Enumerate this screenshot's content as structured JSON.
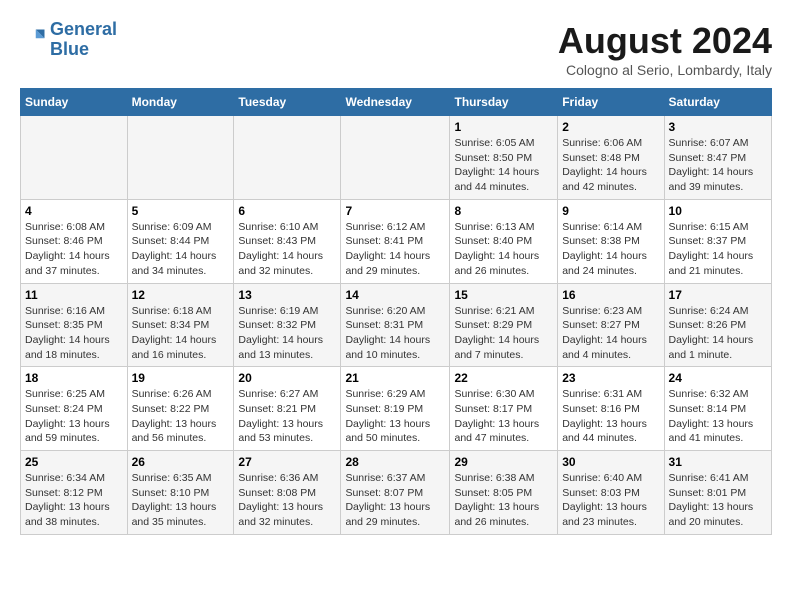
{
  "header": {
    "logo_line1": "General",
    "logo_line2": "Blue",
    "month_title": "August 2024",
    "location": "Cologno al Serio, Lombardy, Italy"
  },
  "days_of_week": [
    "Sunday",
    "Monday",
    "Tuesday",
    "Wednesday",
    "Thursday",
    "Friday",
    "Saturday"
  ],
  "weeks": [
    [
      {
        "day": "",
        "info": ""
      },
      {
        "day": "",
        "info": ""
      },
      {
        "day": "",
        "info": ""
      },
      {
        "day": "",
        "info": ""
      },
      {
        "day": "1",
        "info": "Sunrise: 6:05 AM\nSunset: 8:50 PM\nDaylight: 14 hours\nand 44 minutes."
      },
      {
        "day": "2",
        "info": "Sunrise: 6:06 AM\nSunset: 8:48 PM\nDaylight: 14 hours\nand 42 minutes."
      },
      {
        "day": "3",
        "info": "Sunrise: 6:07 AM\nSunset: 8:47 PM\nDaylight: 14 hours\nand 39 minutes."
      }
    ],
    [
      {
        "day": "4",
        "info": "Sunrise: 6:08 AM\nSunset: 8:46 PM\nDaylight: 14 hours\nand 37 minutes."
      },
      {
        "day": "5",
        "info": "Sunrise: 6:09 AM\nSunset: 8:44 PM\nDaylight: 14 hours\nand 34 minutes."
      },
      {
        "day": "6",
        "info": "Sunrise: 6:10 AM\nSunset: 8:43 PM\nDaylight: 14 hours\nand 32 minutes."
      },
      {
        "day": "7",
        "info": "Sunrise: 6:12 AM\nSunset: 8:41 PM\nDaylight: 14 hours\nand 29 minutes."
      },
      {
        "day": "8",
        "info": "Sunrise: 6:13 AM\nSunset: 8:40 PM\nDaylight: 14 hours\nand 26 minutes."
      },
      {
        "day": "9",
        "info": "Sunrise: 6:14 AM\nSunset: 8:38 PM\nDaylight: 14 hours\nand 24 minutes."
      },
      {
        "day": "10",
        "info": "Sunrise: 6:15 AM\nSunset: 8:37 PM\nDaylight: 14 hours\nand 21 minutes."
      }
    ],
    [
      {
        "day": "11",
        "info": "Sunrise: 6:16 AM\nSunset: 8:35 PM\nDaylight: 14 hours\nand 18 minutes."
      },
      {
        "day": "12",
        "info": "Sunrise: 6:18 AM\nSunset: 8:34 PM\nDaylight: 14 hours\nand 16 minutes."
      },
      {
        "day": "13",
        "info": "Sunrise: 6:19 AM\nSunset: 8:32 PM\nDaylight: 14 hours\nand 13 minutes."
      },
      {
        "day": "14",
        "info": "Sunrise: 6:20 AM\nSunset: 8:31 PM\nDaylight: 14 hours\nand 10 minutes."
      },
      {
        "day": "15",
        "info": "Sunrise: 6:21 AM\nSunset: 8:29 PM\nDaylight: 14 hours\nand 7 minutes."
      },
      {
        "day": "16",
        "info": "Sunrise: 6:23 AM\nSunset: 8:27 PM\nDaylight: 14 hours\nand 4 minutes."
      },
      {
        "day": "17",
        "info": "Sunrise: 6:24 AM\nSunset: 8:26 PM\nDaylight: 14 hours\nand 1 minute."
      }
    ],
    [
      {
        "day": "18",
        "info": "Sunrise: 6:25 AM\nSunset: 8:24 PM\nDaylight: 13 hours\nand 59 minutes."
      },
      {
        "day": "19",
        "info": "Sunrise: 6:26 AM\nSunset: 8:22 PM\nDaylight: 13 hours\nand 56 minutes."
      },
      {
        "day": "20",
        "info": "Sunrise: 6:27 AM\nSunset: 8:21 PM\nDaylight: 13 hours\nand 53 minutes."
      },
      {
        "day": "21",
        "info": "Sunrise: 6:29 AM\nSunset: 8:19 PM\nDaylight: 13 hours\nand 50 minutes."
      },
      {
        "day": "22",
        "info": "Sunrise: 6:30 AM\nSunset: 8:17 PM\nDaylight: 13 hours\nand 47 minutes."
      },
      {
        "day": "23",
        "info": "Sunrise: 6:31 AM\nSunset: 8:16 PM\nDaylight: 13 hours\nand 44 minutes."
      },
      {
        "day": "24",
        "info": "Sunrise: 6:32 AM\nSunset: 8:14 PM\nDaylight: 13 hours\nand 41 minutes."
      }
    ],
    [
      {
        "day": "25",
        "info": "Sunrise: 6:34 AM\nSunset: 8:12 PM\nDaylight: 13 hours\nand 38 minutes."
      },
      {
        "day": "26",
        "info": "Sunrise: 6:35 AM\nSunset: 8:10 PM\nDaylight: 13 hours\nand 35 minutes."
      },
      {
        "day": "27",
        "info": "Sunrise: 6:36 AM\nSunset: 8:08 PM\nDaylight: 13 hours\nand 32 minutes."
      },
      {
        "day": "28",
        "info": "Sunrise: 6:37 AM\nSunset: 8:07 PM\nDaylight: 13 hours\nand 29 minutes."
      },
      {
        "day": "29",
        "info": "Sunrise: 6:38 AM\nSunset: 8:05 PM\nDaylight: 13 hours\nand 26 minutes."
      },
      {
        "day": "30",
        "info": "Sunrise: 6:40 AM\nSunset: 8:03 PM\nDaylight: 13 hours\nand 23 minutes."
      },
      {
        "day": "31",
        "info": "Sunrise: 6:41 AM\nSunset: 8:01 PM\nDaylight: 13 hours\nand 20 minutes."
      }
    ]
  ]
}
